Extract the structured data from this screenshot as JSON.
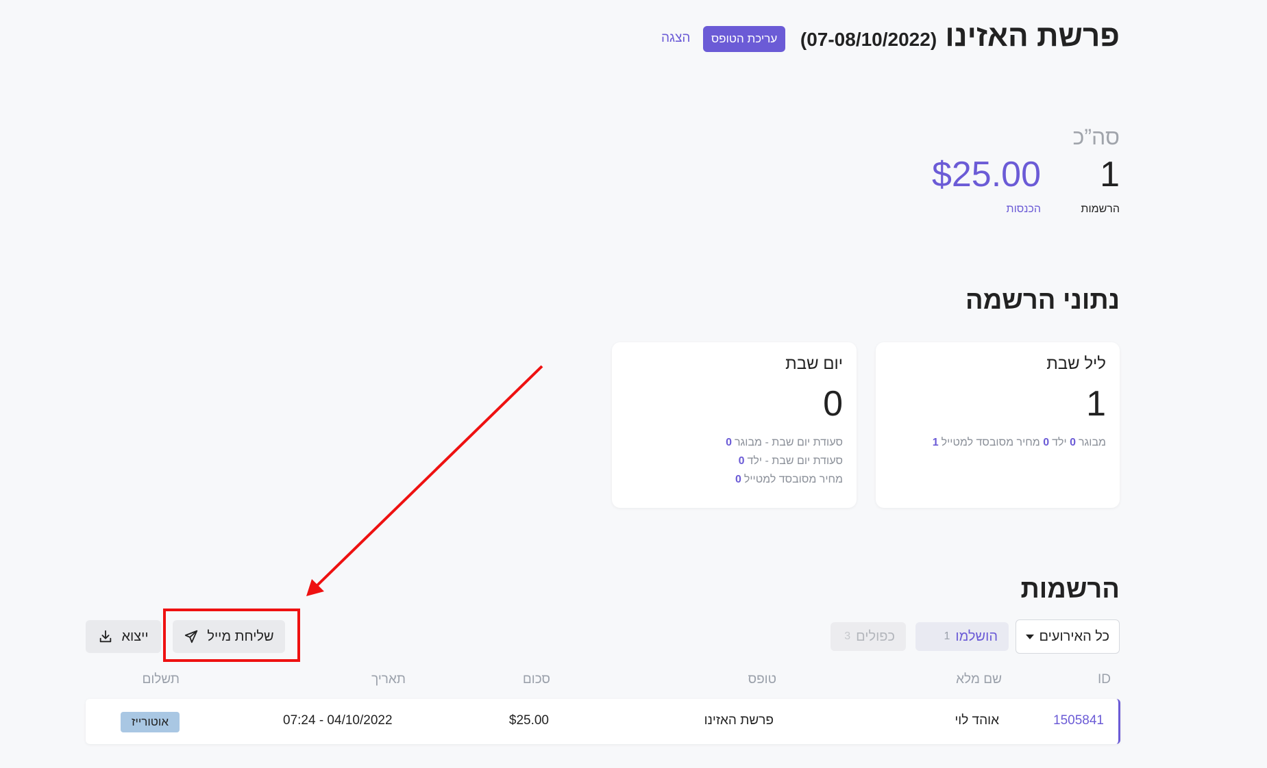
{
  "header": {
    "title": "פרשת האזינו",
    "dates": "(07-08/10/2022)",
    "edit_form_label": "עריכת הטופס",
    "view_label": "הצגה"
  },
  "totals": {
    "label": "סה”כ",
    "registrations_value": "1",
    "registrations_label": "הרשמות",
    "revenue_value": "$25.00",
    "revenue_label": "הכנסות"
  },
  "registration_data": {
    "title": "נתוני הרשמה",
    "cards": [
      {
        "title": "ליל שבת",
        "count": "1",
        "details": [
          {
            "label": "מבוגר",
            "value": "0"
          },
          {
            "label": "ילד",
            "value": "0"
          },
          {
            "label": "מחיר מסובסד למטייל",
            "value": "1"
          }
        ]
      },
      {
        "title": "יום שבת",
        "count": "0",
        "details": [
          {
            "label": "סעודת יום שבת - מבוגר",
            "value": "0"
          },
          {
            "label": "סעודת יום שבת - ילד",
            "value": "0"
          },
          {
            "label": "מחיר מסובסד למטייל",
            "value": "0"
          }
        ]
      }
    ]
  },
  "registrations": {
    "title": "הרשמות",
    "filter_select": "כל האירועים",
    "completed": {
      "label": "הושלמו",
      "count": "1"
    },
    "duplicates": {
      "label": "כפולים",
      "count": "3"
    },
    "send_email_label": "שליחת מייל",
    "export_label": "ייצוא",
    "columns": [
      "ID",
      "שם מלא",
      "טופס",
      "סכום",
      "תאריך",
      "תשלום"
    ],
    "rows": [
      {
        "id": "1505841",
        "name": "אוהד לוי",
        "form": "פרשת האזינו",
        "amount": "$25.00",
        "date": "07:24 - 04/10/2022",
        "payment": "אוטורייז"
      }
    ]
  },
  "colors": {
    "accent": "#6b5bd6",
    "annotation": "#ee1111",
    "badge": "#a9c7e3"
  },
  "icons": {
    "send": "paper-plane-icon",
    "export": "download-icon",
    "select": "caret-down-icon"
  }
}
